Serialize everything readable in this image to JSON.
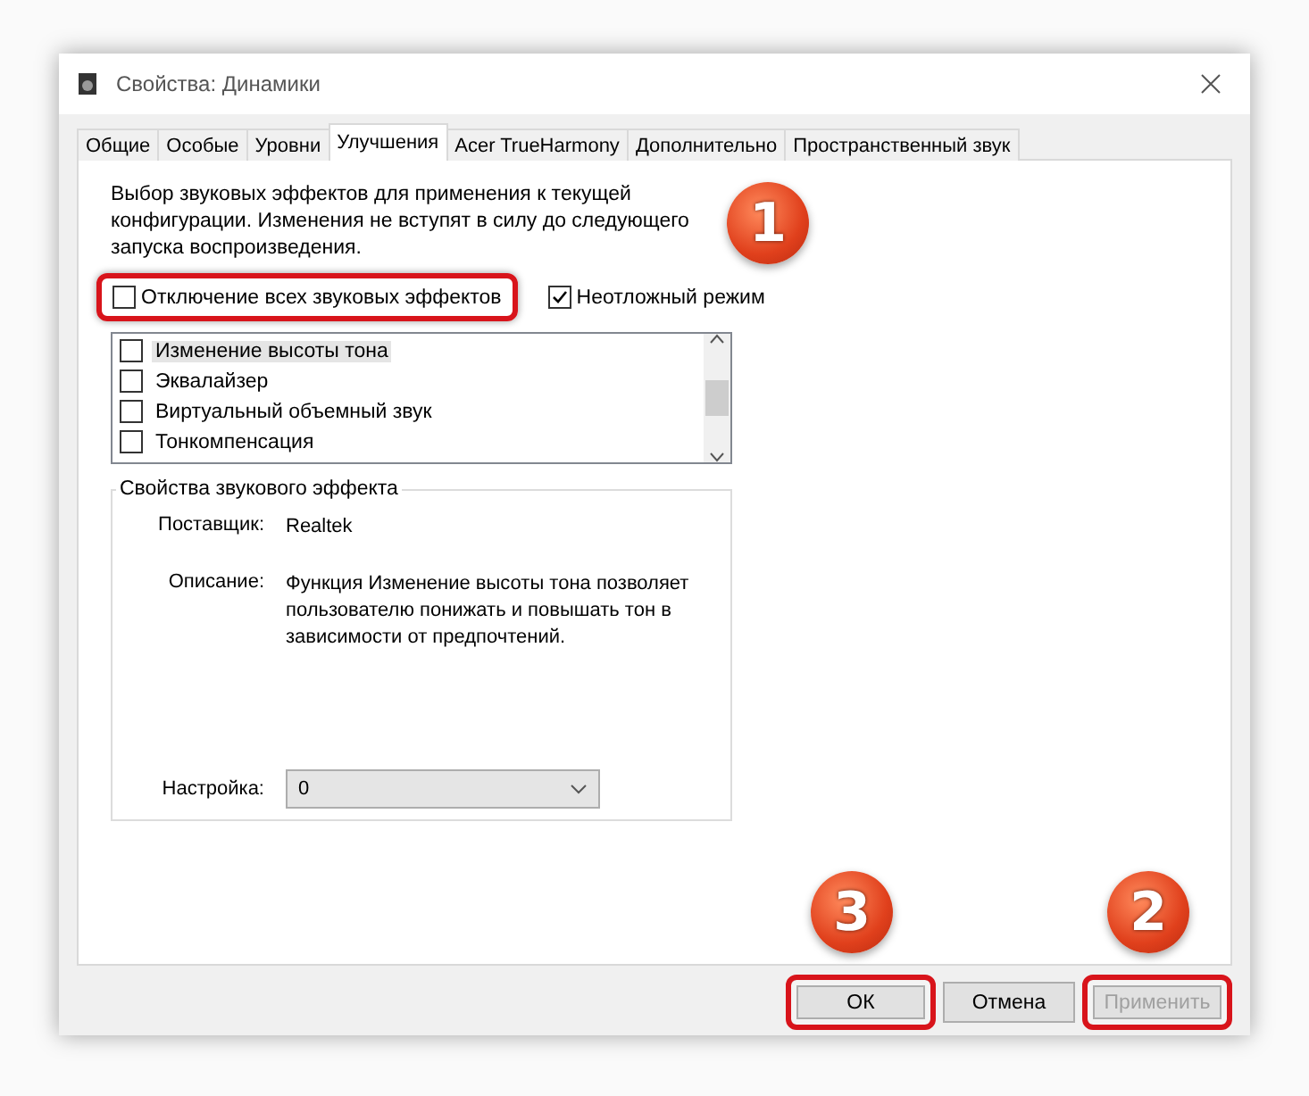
{
  "window": {
    "title": "Свойства: Динамики"
  },
  "tabs": [
    {
      "label": "Общие",
      "selected": false
    },
    {
      "label": "Особые",
      "selected": false
    },
    {
      "label": "Уровни",
      "selected": false
    },
    {
      "label": "Улучшения",
      "selected": true
    },
    {
      "label": "Acer TrueHarmony",
      "selected": false
    },
    {
      "label": "Дополнительно",
      "selected": false
    },
    {
      "label": "Пространственный звук",
      "selected": false
    }
  ],
  "description": "Выбор звуковых эффектов для применения к текущей конфигурации. Изменения не вступят в силу до следующего запуска воспроизведения.",
  "options": [
    {
      "label": "Отключение всех звуковых эффектов",
      "checked": false,
      "highlighted": true
    },
    {
      "label": "Неотложный режим",
      "checked": true,
      "highlighted": false
    }
  ],
  "effects": [
    {
      "label": "Изменение высоты тона",
      "checked": false,
      "selected": true
    },
    {
      "label": "Эквалайзер",
      "checked": false,
      "selected": false
    },
    {
      "label": "Виртуальный объемный звук",
      "checked": false,
      "selected": false
    },
    {
      "label": "Тонкомпенсация",
      "checked": false,
      "selected": false
    }
  ],
  "properties": {
    "title": "Свойства звукового эффекта",
    "provider_label": "Поставщик:",
    "provider": "Realtek",
    "description_label": "Описание:",
    "description": "Функция Изменение высоты тона позволяет пользователю понижать и повышать тон в зависимости от предпочтений.",
    "setting_label": "Настройка:",
    "setting": "0"
  },
  "buttons": [
    {
      "label": "ОК",
      "disabled": false,
      "highlighted": true,
      "callout": "3"
    },
    {
      "label": "Отмена",
      "disabled": false,
      "highlighted": false
    },
    {
      "label": "Применить",
      "disabled": true,
      "highlighted": true,
      "callout": "2"
    }
  ],
  "option_callout": "1"
}
